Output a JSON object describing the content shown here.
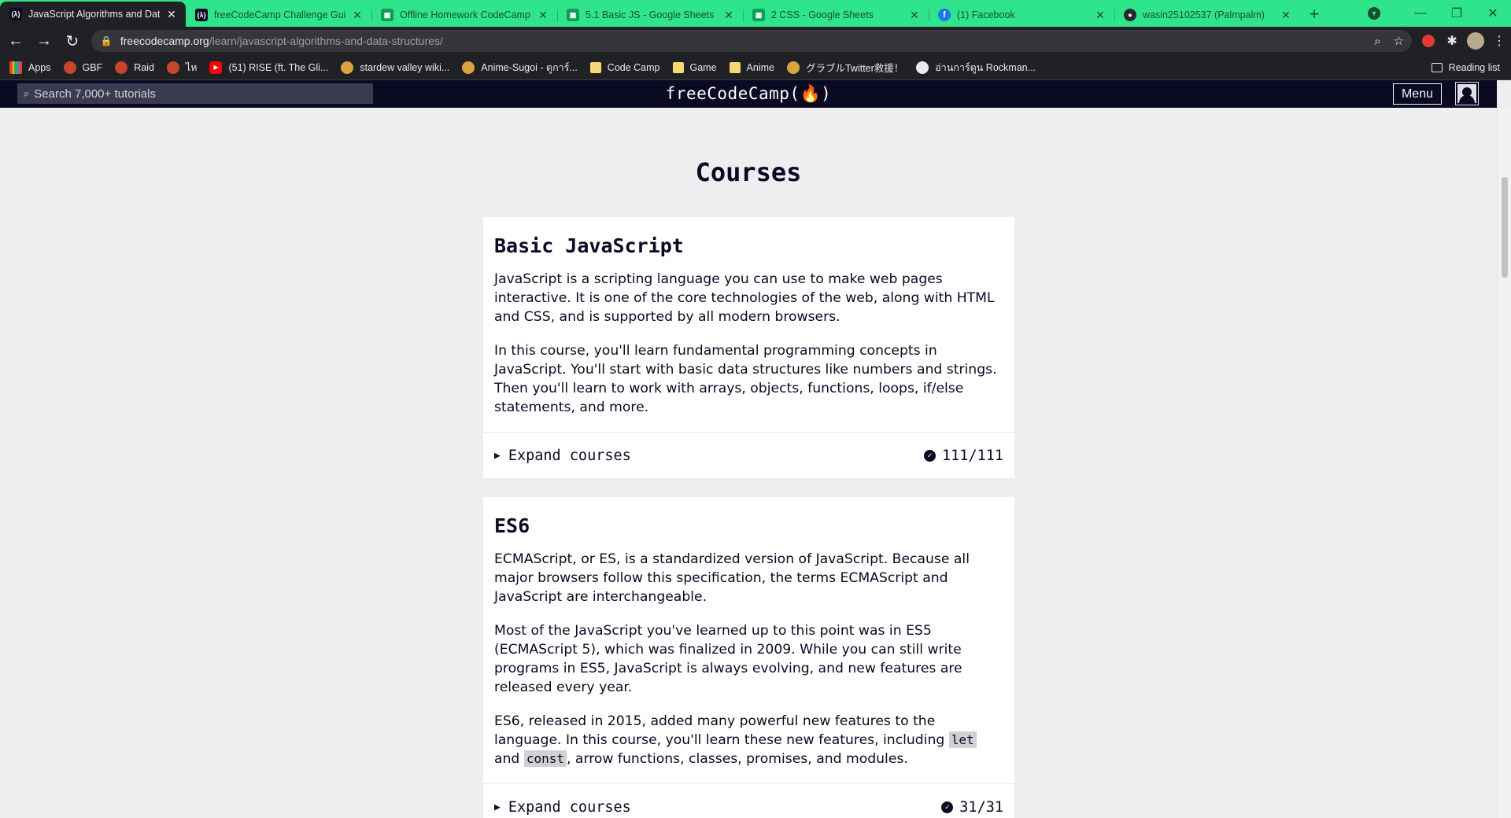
{
  "browser": {
    "tabs": [
      {
        "title": "JavaScript Algorithms and Data",
        "icon": "freecodecamp-icon",
        "active": true
      },
      {
        "title": "freeCodeCamp Challenge Guide",
        "icon": "freecodecamp-icon",
        "active": false
      },
      {
        "title": "Offline Homework CodeCamp #",
        "icon": "google-sheets-icon",
        "active": false
      },
      {
        "title": "5.1 Basic JS - Google Sheets",
        "icon": "google-sheets-icon",
        "active": false
      },
      {
        "title": "2 CSS - Google Sheets",
        "icon": "google-sheets-icon",
        "active": false
      },
      {
        "title": "(1) Facebook",
        "icon": "facebook-icon",
        "active": false
      },
      {
        "title": "wasin25102537 (Palmpalm)",
        "icon": "github-icon",
        "active": false
      }
    ],
    "url_host": "freecodecamp.org",
    "url_path": "/learn/javascript-algorithms-and-data-structures/",
    "bookmarks": [
      {
        "label": "Apps",
        "icon": "apps-grid-icon"
      },
      {
        "label": "GBF",
        "icon": "gbf-icon"
      },
      {
        "label": "Raid",
        "icon": "gbf-icon"
      },
      {
        "label": "ไห",
        "icon": "gbf-icon"
      },
      {
        "label": "(51) RISE (ft. The Gli...",
        "icon": "youtube-icon"
      },
      {
        "label": "stardew valley wiki...",
        "icon": "stardew-icon"
      },
      {
        "label": "Anime-Sugoi - ดูการ์...",
        "icon": "anime-sugoi-icon"
      },
      {
        "label": "Code Camp",
        "icon": "folder-icon"
      },
      {
        "label": "Game",
        "icon": "folder-icon"
      },
      {
        "label": "Anime",
        "icon": "folder-icon"
      },
      {
        "label": "グラブルTwitter救援！",
        "icon": "gbf-twitter-icon"
      },
      {
        "label": "อ่านการ์ตูน Rockman...",
        "icon": "globe-icon"
      }
    ],
    "reading_list": "Reading list"
  },
  "fcc_nav": {
    "search_placeholder": "Search 7,000+ tutorials",
    "logo": "freeCodeCamp(🔥)",
    "logo_text": "freeCodeCamp",
    "menu_label": "Menu"
  },
  "main": {
    "title": "Courses",
    "courses": [
      {
        "name": "Basic JavaScript",
        "paragraphs": [
          "JavaScript is a scripting language you can use to make web pages interactive. It is one of the core technologies of the web, along with HTML and CSS, and is supported by all modern browsers.",
          "In this course, you'll learn fundamental programming concepts in JavaScript. You'll start with basic data structures like numbers and strings. Then you'll learn to work with arrays, objects, functions, loops, if/else statements, and more."
        ],
        "expand_label": "Expand courses",
        "progress": "111/111"
      },
      {
        "name": "ES6",
        "paragraphs": [
          "ECMAScript, or ES, is a standardized version of JavaScript. Because all major browsers follow this specification, the terms ECMAScript and JavaScript are interchangeable.",
          "Most of the JavaScript you've learned up to this point was in ES5 (ECMAScript 5), which was finalized in 2009. While you can still write programs in ES5, JavaScript is always evolving, and new features are released every year."
        ],
        "p3_before": "ES6, released in 2015, added many powerful new features to the language. In this course, you'll learn these new features, including ",
        "p3_code1": "let",
        "p3_and": " and ",
        "p3_code2": "const",
        "p3_after": ", arrow functions, classes, promises, and modules.",
        "expand_label": "Expand courses",
        "progress": "31/31"
      }
    ]
  },
  "colors": {
    "tab_strip": "#2ee58b",
    "fcc_nav": "#0a0a23",
    "page_bg": "#eeeef0",
    "card_bg": "#ffffff"
  }
}
